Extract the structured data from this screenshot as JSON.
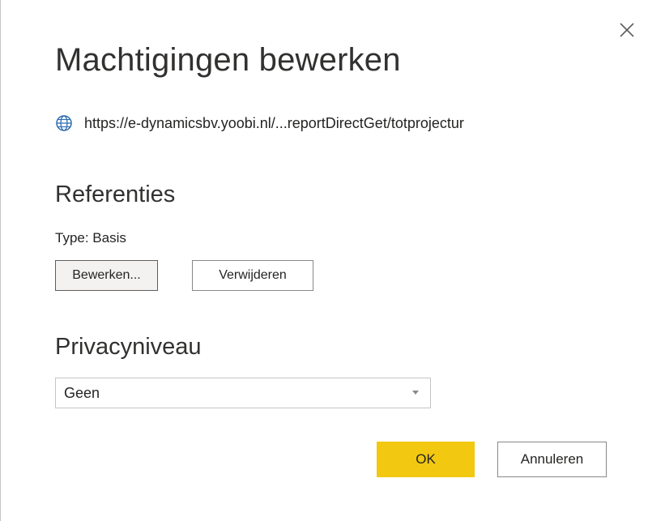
{
  "dialog": {
    "title": "Machtigingen bewerken",
    "close_icon": "close-icon",
    "url_icon": "globe-icon",
    "url": "https://e-dynamicsbv.yoobi.nl/...reportDirectGet/totprojectur"
  },
  "credentials": {
    "heading": "Referenties",
    "type_label": "Type: Basis",
    "edit_label": "Bewerken...",
    "delete_label": "Verwijderen"
  },
  "privacy": {
    "heading": "Privacyniveau",
    "selected": "Geen"
  },
  "footer": {
    "ok_label": "OK",
    "cancel_label": "Annuleren"
  },
  "colors": {
    "accent": "#f2c811",
    "text": "#252423",
    "border": "#8a8886"
  }
}
